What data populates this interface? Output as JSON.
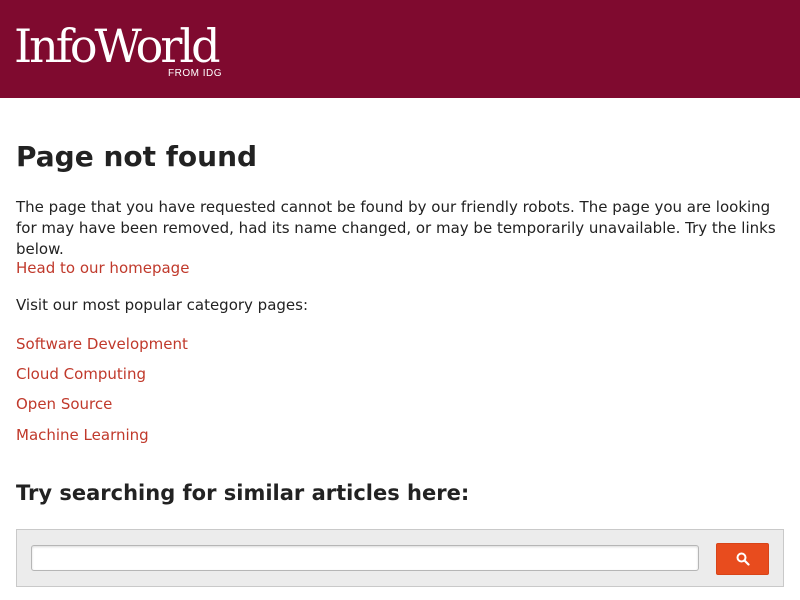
{
  "header": {
    "logo_text": "InfoWorld",
    "logo_subtext": "FROM IDG",
    "background_color": "#7f0a2f"
  },
  "main": {
    "title": "Page not found",
    "intro": "The page that you have requested cannot be found by our friendly robots. The page you are looking for may have been removed, had its name changed, or may be temporarily unavailable. Try the links below.",
    "homepage_link": "Head to our homepage",
    "categories_heading": "Visit our most popular category pages:",
    "categories": [
      "Software Development",
      "Cloud Computing",
      "Open Source",
      "Machine Learning"
    ],
    "search_heading": "Try searching for similar articles here:"
  },
  "search": {
    "value": "",
    "button_icon": "search-icon",
    "button_color": "#e84c1e"
  },
  "colors": {
    "link": "#c0392b",
    "text": "#222222"
  }
}
